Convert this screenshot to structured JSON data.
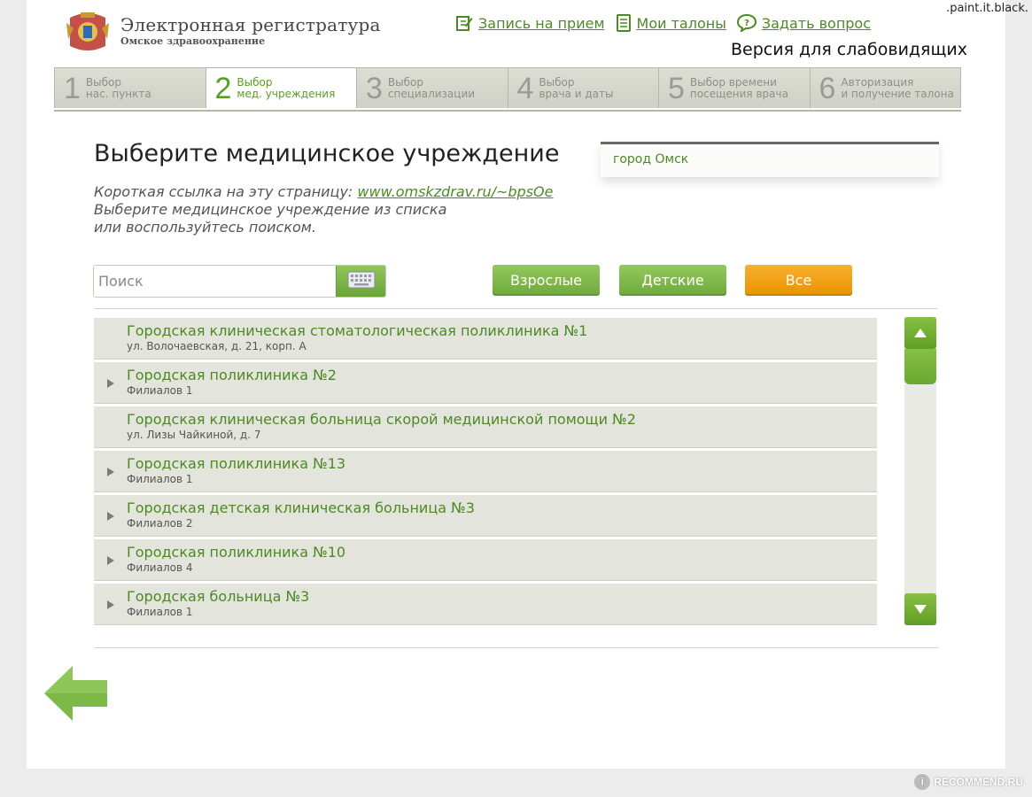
{
  "watermark": {
    "top": ".paint.it.black.",
    "bottom": "RECOMMEND.RU"
  },
  "header": {
    "logo_icon": "coat-of-arms-icon",
    "title": "Электронная регистратура",
    "subtitle": "Омское здравоохранение",
    "links": [
      {
        "label": "Запись на прием",
        "icon": "edit-icon"
      },
      {
        "label": "Мои талоны",
        "icon": "ticket-icon"
      },
      {
        "label": "Задать вопрос",
        "icon": "question-icon"
      }
    ],
    "low_vision": "Версия для слабовидящих"
  },
  "steps": [
    {
      "num": "1",
      "label": "Выбор\nнас. пункта",
      "active": false
    },
    {
      "num": "2",
      "label": "Выбор\nмед. учреждения",
      "active": true
    },
    {
      "num": "3",
      "label": "Выбор\nспециализации",
      "active": false
    },
    {
      "num": "4",
      "label": "Выбор\nврача и даты",
      "active": false
    },
    {
      "num": "5",
      "label": "Выбор времени\nпосещения врача",
      "active": false
    },
    {
      "num": "6",
      "label": "Авторизация\nи получение талона",
      "active": false
    }
  ],
  "main": {
    "title": "Выберите медицинское учреждение",
    "city": "город Омск",
    "short_link_label": "Короткая ссылка на эту страницу:",
    "short_link": "www.omskzdrav.ru/~bpsOe",
    "hint_line2": "Выберите медицинское учреждение из списка",
    "hint_line3": "или воспользуйтесь поиском."
  },
  "search": {
    "placeholder": "Поиск",
    "value": "",
    "keyboard_icon": "keyboard-icon"
  },
  "filters": {
    "adults": "Взрослые",
    "children": "Детские",
    "all": "Все",
    "active": "all"
  },
  "institutions": [
    {
      "name": "Городская клиническая стоматологическая поликлиника №1",
      "sub": "ул. Волочаевская, д. 21, корп. А",
      "expandable": false
    },
    {
      "name": "Городская поликлиника №2",
      "sub": "Филиалов 1",
      "expandable": true
    },
    {
      "name": "Городская клиническая больница скорой медицинской помощи №2",
      "sub": "ул. Лизы Чайкиной, д. 7",
      "expandable": false
    },
    {
      "name": "Городская поликлиника №13",
      "sub": "Филиалов 1",
      "expandable": true
    },
    {
      "name": "Городская детская клиническая больница №3",
      "sub": "Филиалов 2",
      "expandable": true
    },
    {
      "name": "Городская поликлиника №10",
      "sub": "Филиалов 4",
      "expandable": true
    },
    {
      "name": "Городская больница №3",
      "sub": "Филиалов 1",
      "expandable": true
    }
  ],
  "colors": {
    "accent_green": "#4c8a23",
    "button_green": "#7ab547",
    "button_orange": "#f2a114"
  },
  "icons": {
    "scroll_up": "triangle-up-icon",
    "scroll_down": "triangle-down-icon",
    "back": "back-arrow-icon"
  }
}
